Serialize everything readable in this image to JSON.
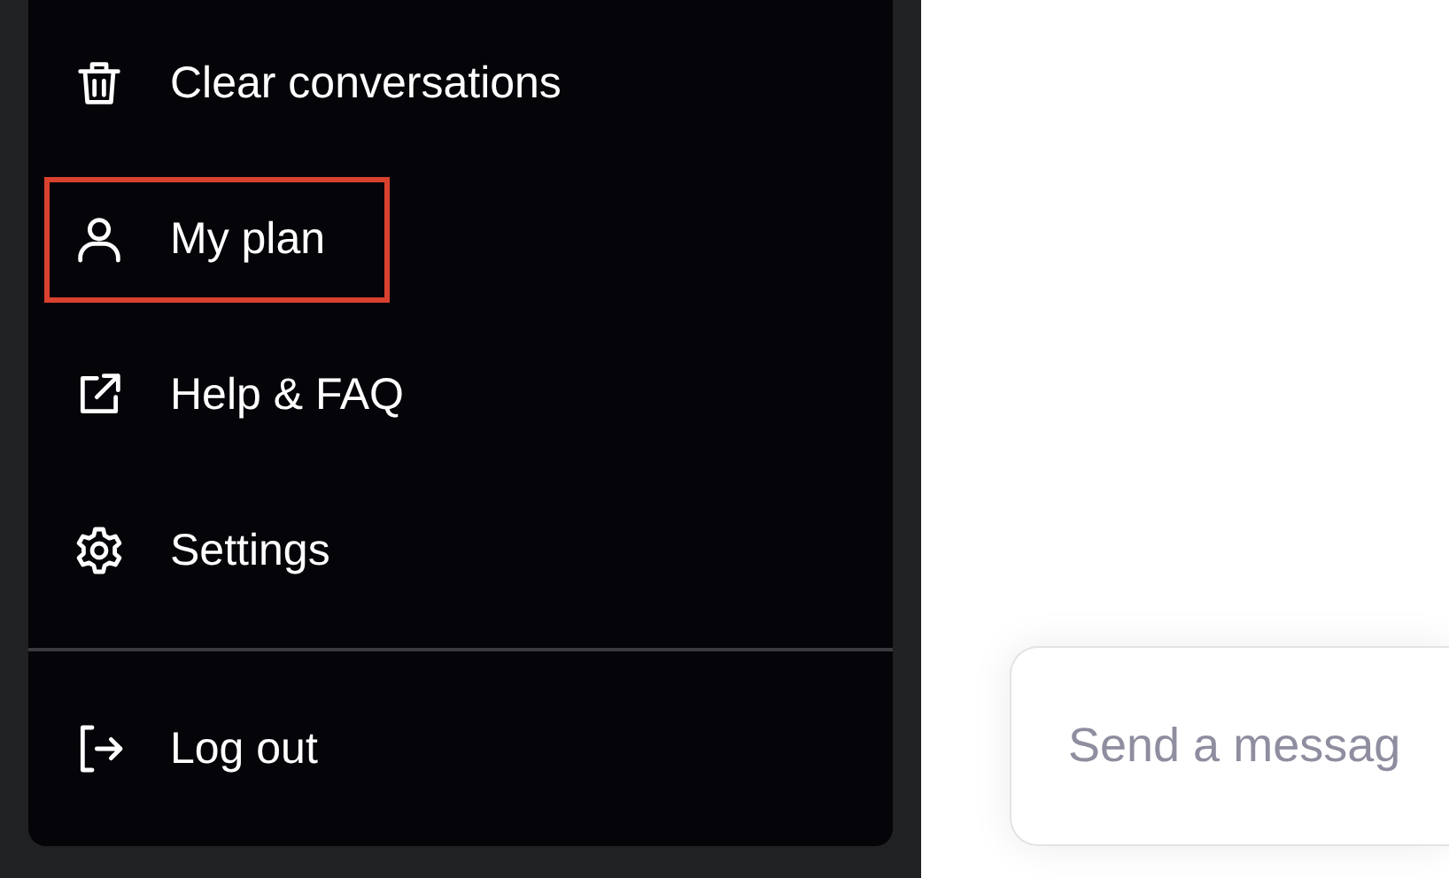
{
  "menu": {
    "items": [
      {
        "kind": "trash",
        "label": "Clear conversations",
        "highlighted": false
      },
      {
        "kind": "user",
        "label": "My plan",
        "highlighted": true
      },
      {
        "kind": "external-link",
        "label": "Help & FAQ",
        "highlighted": false
      },
      {
        "kind": "gear",
        "label": "Settings",
        "highlighted": false
      }
    ],
    "footer_items": [
      {
        "kind": "logout",
        "label": "Log out",
        "highlighted": false
      }
    ]
  },
  "composer": {
    "placeholder": "Send a messag"
  }
}
